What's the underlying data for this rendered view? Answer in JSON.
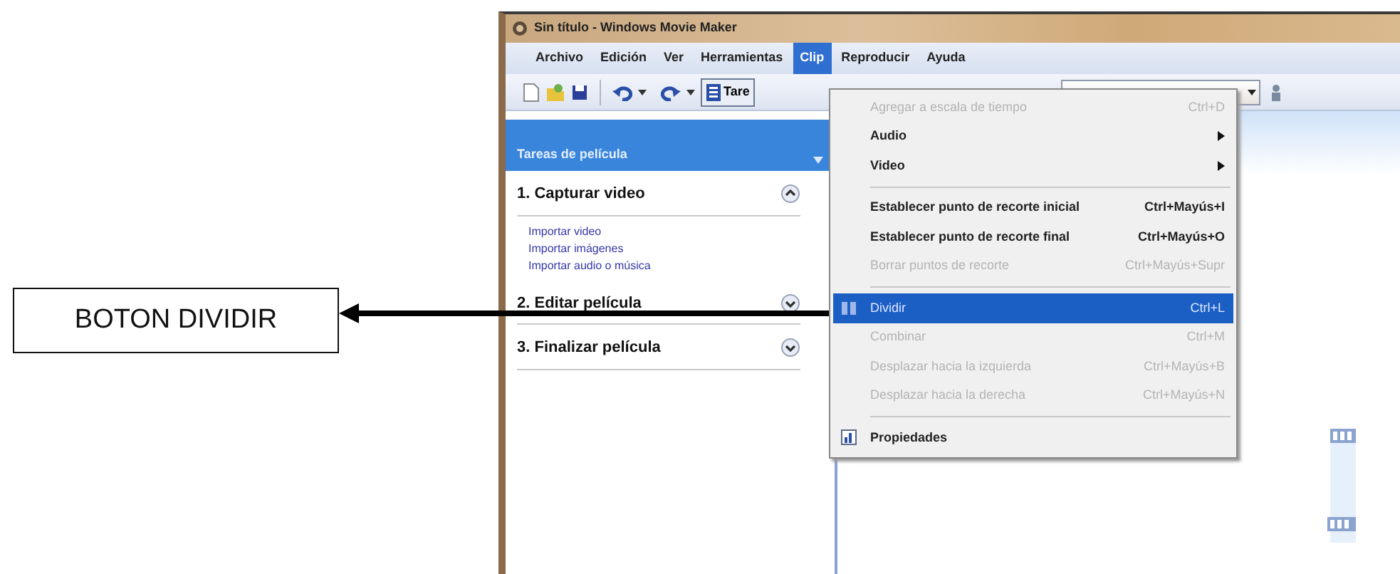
{
  "callout": {
    "text": "BOTON DIVIDIR"
  },
  "window": {
    "title": "Sin título - Windows Movie Maker"
  },
  "menu_bar": [
    {
      "label": "Archivo",
      "selected": false
    },
    {
      "label": "Edición",
      "selected": false
    },
    {
      "label": "Ver",
      "selected": false
    },
    {
      "label": "Herramientas",
      "selected": false
    },
    {
      "label": "Clip",
      "selected": true
    },
    {
      "label": "Reproducir",
      "selected": false
    },
    {
      "label": "Ayuda",
      "selected": false
    }
  ],
  "toolbar": {
    "tasks_button": "Tare"
  },
  "task_pane": {
    "title": "Tareas de película",
    "sections": [
      {
        "title": "1. Capturar video",
        "expanded": true,
        "links": [
          "Importar video",
          "Importar imágenes",
          "Importar audio o música"
        ]
      },
      {
        "title": "2. Editar película",
        "expanded": false
      },
      {
        "title": "3. Finalizar película",
        "expanded": false
      }
    ]
  },
  "clip_menu": {
    "items": [
      {
        "kind": "item",
        "label": "Agregar a escala de tiempo",
        "shortcut": "Ctrl+D",
        "disabled": true,
        "submenu": false,
        "selected": false
      },
      {
        "kind": "item",
        "label": "Audio",
        "disabled": false,
        "submenu": true,
        "selected": false
      },
      {
        "kind": "item",
        "label": "Video",
        "disabled": false,
        "submenu": true,
        "selected": false
      },
      {
        "kind": "separator"
      },
      {
        "kind": "item",
        "label": "Establecer punto de recorte inicial",
        "shortcut": "Ctrl+Mayús+I",
        "disabled": false,
        "submenu": false,
        "selected": false
      },
      {
        "kind": "item",
        "label": "Establecer punto de recorte final",
        "shortcut": "Ctrl+Mayús+O",
        "disabled": false,
        "submenu": false,
        "selected": false
      },
      {
        "kind": "item",
        "label": "Borrar puntos de recorte",
        "shortcut": "Ctrl+Mayús+Supr",
        "disabled": true,
        "submenu": false,
        "selected": false
      },
      {
        "kind": "separator"
      },
      {
        "kind": "icon_item",
        "label": "Dividir",
        "shortcut": "Ctrl+L",
        "disabled": false,
        "submenu": false,
        "selected": true
      },
      {
        "kind": "item",
        "label": "Combinar",
        "shortcut": "Ctrl+M",
        "disabled": true,
        "submenu": false,
        "selected": false
      },
      {
        "kind": "item",
        "label": "Desplazar hacia la izquierda",
        "shortcut": "Ctrl+Mayús+B",
        "disabled": true,
        "submenu": false,
        "selected": false
      },
      {
        "kind": "item",
        "label": "Desplazar hacia la derecha",
        "shortcut": "Ctrl+Mayús+N",
        "disabled": true,
        "submenu": false,
        "selected": false
      },
      {
        "kind": "separator"
      },
      {
        "kind": "icon_item",
        "label": "Propiedades",
        "disabled": false,
        "submenu": false,
        "selected": false
      }
    ]
  }
}
